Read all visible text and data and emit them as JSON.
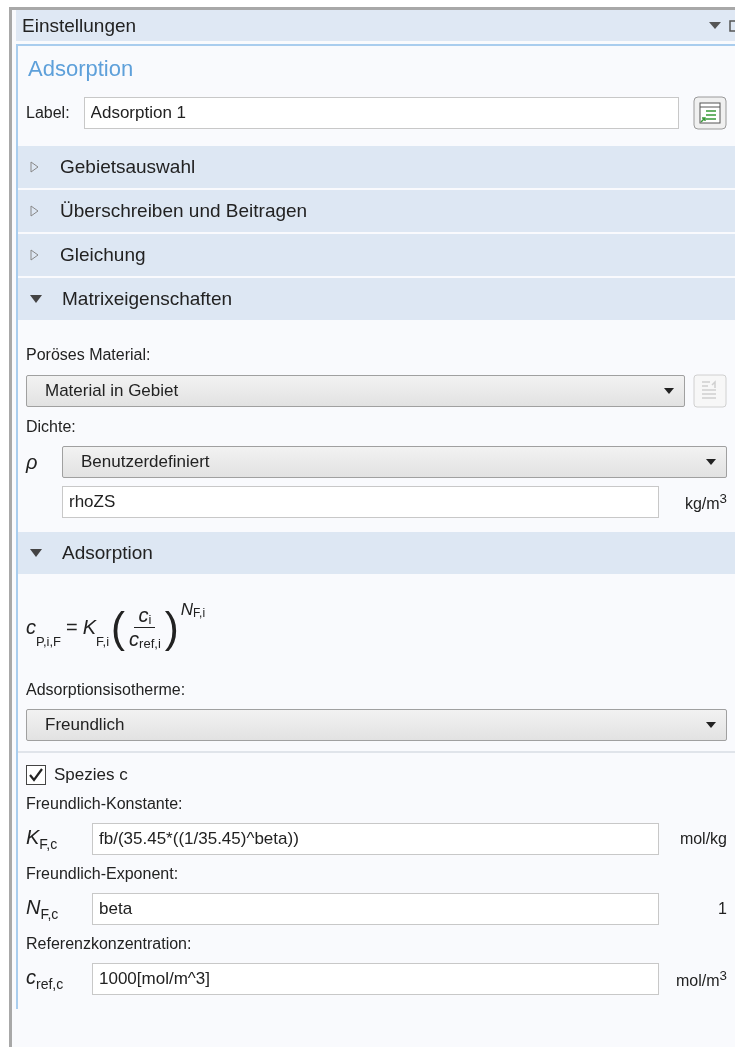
{
  "panel": {
    "title": "Einstellungen"
  },
  "feature": {
    "title": "Adsorption",
    "label_caption": "Label:",
    "label_value": "Adsorption 1"
  },
  "sections": [
    {
      "title": "Gebietsauswahl",
      "expanded": false
    },
    {
      "title": "Überschreiben und Beitragen",
      "expanded": false
    },
    {
      "title": "Gleichung",
      "expanded": false
    },
    {
      "title": "Matrixeigenschaften",
      "expanded": true,
      "body": {
        "kind": "matrix",
        "material_caption": "Poröses Material:",
        "material_select": "Material in Gebiet",
        "density_caption": "Dichte:",
        "density_symbol": "ρ",
        "density_select": "Benutzerdefiniert",
        "density_value": "rhoZS",
        "density_unit": "kg/m$^{3}$"
      }
    },
    {
      "title": "Adsorption",
      "expanded": true,
      "body": {
        "kind": "adsorption",
        "formula": {
          "lhs": "c",
          "lhs_sub": "P,i,F",
          "equals": "=",
          "coef": "K",
          "coef_sub": "F,i",
          "open": "(",
          "num": "c",
          "num_sub": "i",
          "den": "c",
          "den_sub": "ref,i",
          "close": ")",
          "exp": "N",
          "exp_sub": "F,i"
        },
        "isotherm_caption": "Adsorptionsisotherme:",
        "isotherm_select": "Freundlich",
        "species": {
          "label": "Spezies c",
          "checked": true
        },
        "params": [
          {
            "caption": "Freundlich-Konstante:",
            "symbol": "K",
            "symbol_sub": "F,c",
            "value": "fb/(35.45*((1/35.45)^beta))",
            "unit": "mol/kg"
          },
          {
            "caption": "Freundlich-Exponent:",
            "symbol": "N",
            "symbol_sub": "F,c",
            "value": "beta",
            "unit": "1"
          },
          {
            "caption": "Referenzkonzentration:",
            "symbol": "c",
            "symbol_sub": "ref,c",
            "value": "1000[mol/m^3]",
            "unit": "mol/m$^{3}$"
          }
        ]
      }
    }
  ]
}
